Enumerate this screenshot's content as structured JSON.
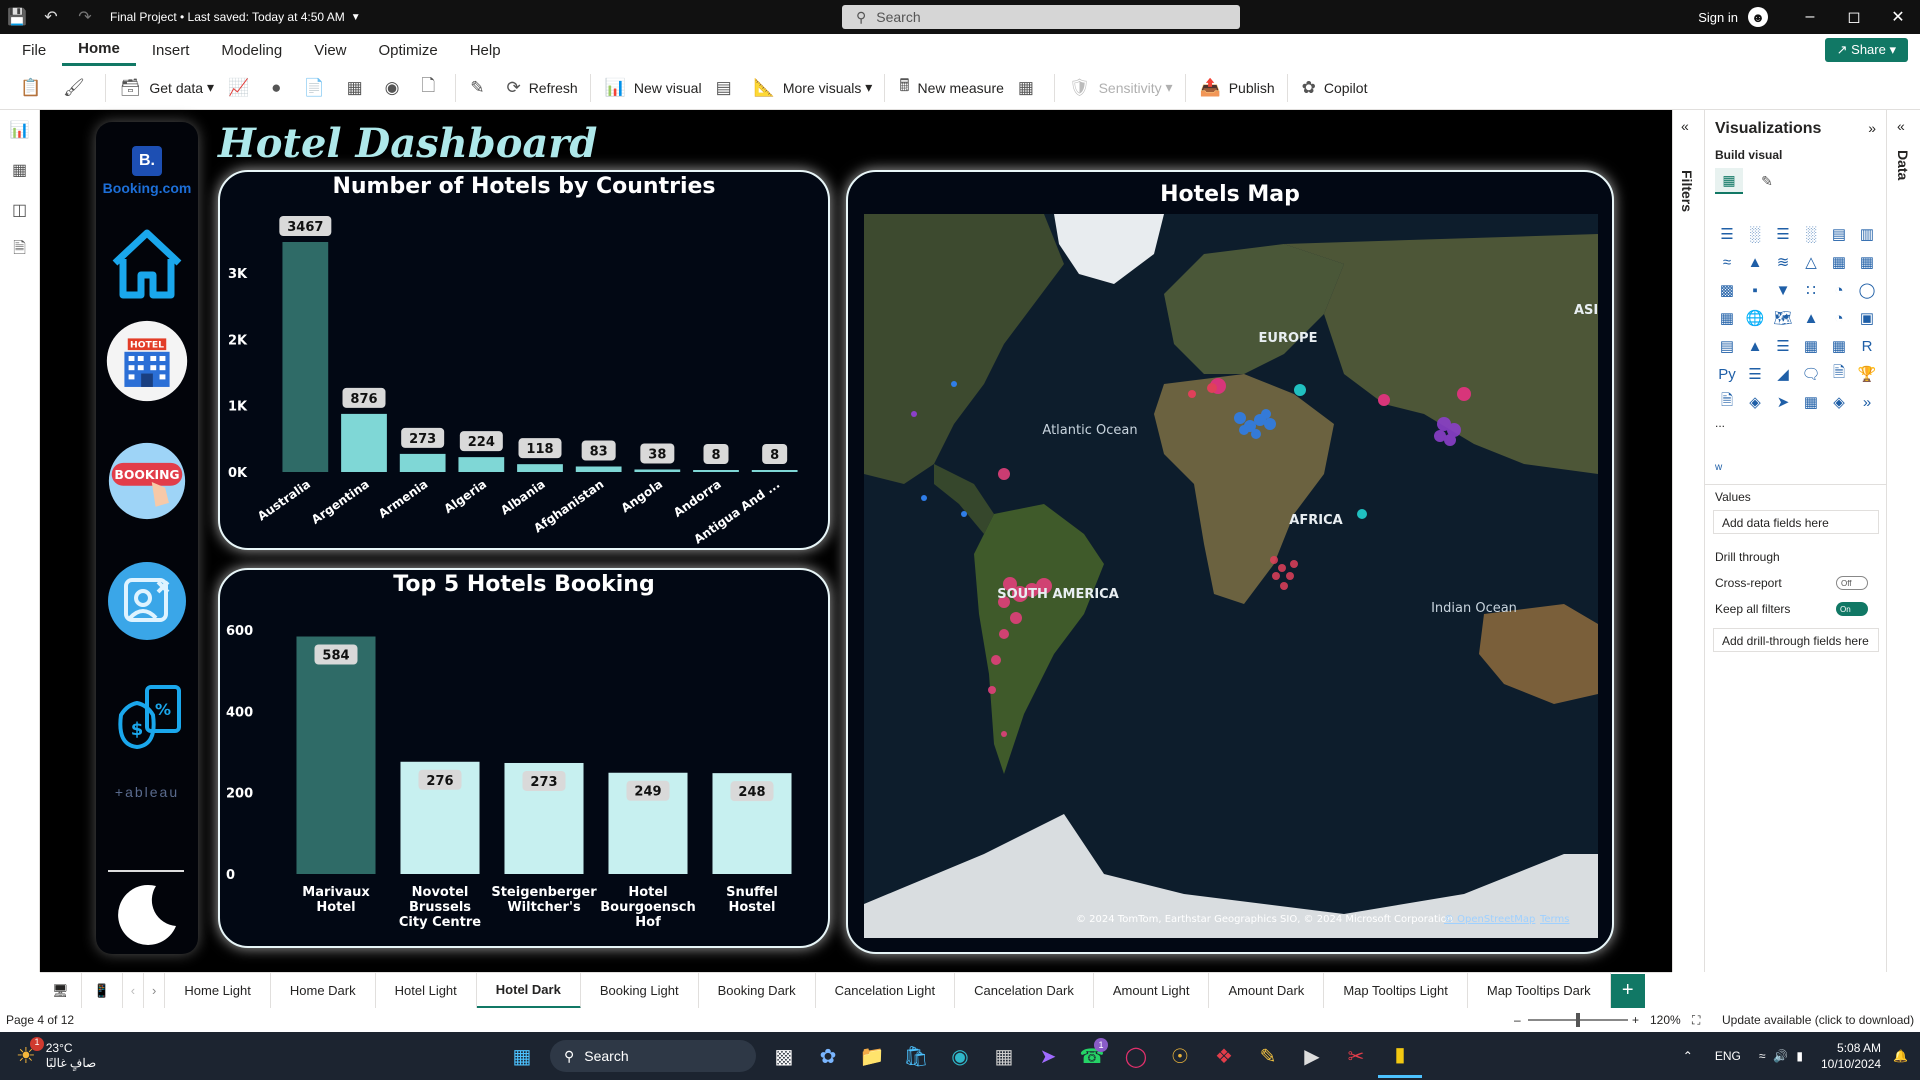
{
  "titlebar": {
    "title": "Final Project • Last saved: Today at 4:50 AM",
    "search_placeholder": "Search",
    "signin": "Sign in"
  },
  "menu": {
    "items": [
      "File",
      "Home",
      "Insert",
      "Modeling",
      "View",
      "Optimize",
      "Help"
    ],
    "active": "Home",
    "share": "Share"
  },
  "ribbon": {
    "get_data": "Get data",
    "refresh": "Refresh",
    "new_visual": "New visual",
    "more_visuals": "More visuals",
    "new_measure": "New measure",
    "sensitivity": "Sensitivity",
    "publish": "Publish",
    "copilot": "Copilot"
  },
  "panes": {
    "filters": "Filters",
    "data": "Data",
    "visualizations": "Visualizations",
    "build_visual": "Build visual",
    "values": "Values",
    "add_data_fields": "Add data fields here",
    "drill_through": "Drill through",
    "cross_report": "Cross-report",
    "cross_report_state": "Off",
    "keep_all_filters": "Keep all filters",
    "keep_all_filters_state": "On",
    "add_drill_fields": "Add drill-through fields here",
    "more": "...",
    "w_label": "w"
  },
  "dashboard": {
    "title": "Hotel Dashboard",
    "brand": "Booking.com",
    "brand_letter": "B.",
    "hotel_sign": "HOTEL",
    "booking_sign": "BOOKING",
    "tableau_label": "+ableau",
    "map_title": "Hotels Map",
    "map_labels": {
      "europe": "EUROPE",
      "asia": "ASIA",
      "africa": "AFRICA",
      "south_america": "SOUTH AMERICA",
      "atlantic": "Atlantic Ocean",
      "indian": "Indian Ocean"
    },
    "map_attribution": "© 2024 TomTom, Earthstar Geographics SIO, © 2024 Microsoft Corporation",
    "map_osm": "© OpenStreetMap",
    "map_terms": "Terms"
  },
  "chart_data": [
    {
      "type": "bar",
      "title": "Number of Hotels by Countries",
      "categories": [
        "Australia",
        "Argentina",
        "Armenia",
        "Algeria",
        "Albania",
        "Afghanistan",
        "Angola",
        "Andorra",
        "Antigua And ..."
      ],
      "values": [
        3467,
        876,
        273,
        224,
        118,
        83,
        38,
        8,
        8
      ],
      "ylim": [
        0,
        3467
      ],
      "yticks": [
        "0K",
        "1K",
        "2K",
        "3K"
      ],
      "colors": {
        "highlight": "#2f6b67",
        "normal": "#7fd7d6"
      }
    },
    {
      "type": "bar",
      "title": "Top 5 Hotels Booking",
      "categories": [
        "Marivaux Hotel",
        "Novotel Brussels City Centre",
        "Steigenberger Wiltcher's",
        "Hotel Bourgoensch Hof",
        "Snuffel Hostel"
      ],
      "values": [
        584,
        276,
        273,
        249,
        248
      ],
      "ylim": [
        0,
        600
      ],
      "yticks": [
        "0",
        "200",
        "400",
        "600"
      ],
      "colors": {
        "highlight": "#2f6b67",
        "normal": "#c7f0f0"
      }
    }
  ],
  "tabs": {
    "items": [
      "Home Light",
      "Home Dark",
      "Hotel Light",
      "Hotel Dark",
      "Booking Light",
      "Booking Dark",
      "Cancelation Light",
      "Cancelation Dark",
      "Amount Light",
      "Amount Dark",
      "Map Tooltips Light",
      "Map Tooltips Dark"
    ],
    "active": "Hotel Dark"
  },
  "status": {
    "page": "Page 4 of 12",
    "zoom": "120%",
    "update": "Update available (click to download)"
  },
  "taskbar": {
    "temp": "23°C",
    "weather": "صافٍ غالبًا",
    "search": "Search",
    "lang": "ENG",
    "time": "5:08 AM",
    "date": "10/10/2024",
    "badge_weather": "1",
    "badge_whatsapp": "1"
  }
}
